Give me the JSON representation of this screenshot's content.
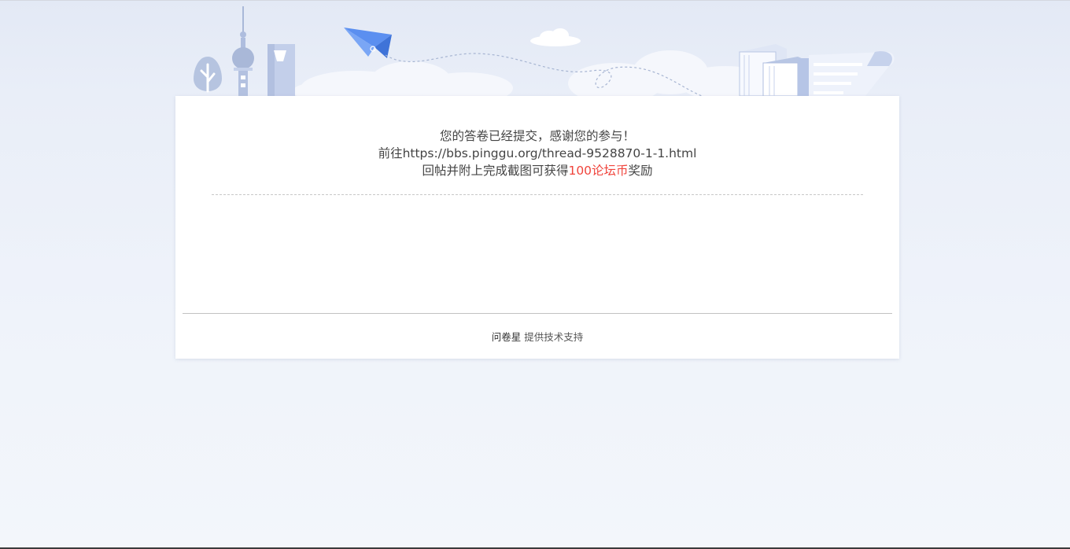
{
  "confirmation": {
    "line1": "您的答卷已经提交，感谢您的参与！",
    "line2": "前往https://bbs.pinggu.org/thread-9528870-1-1.html",
    "line3_before": "回帖并附上完成截图可获得",
    "line3_highlight": "100论坛币",
    "line3_after": "奖励"
  },
  "footer": {
    "brand": "问卷星",
    "support_text": "提供技术支持"
  },
  "colors": {
    "highlight": "#f0443c",
    "page_background": "#eef2f9",
    "card_background": "#ffffff"
  },
  "banner_icons": [
    "tree-icon",
    "tv-tower-icon",
    "skyscraper-icon",
    "paper-plane-icon",
    "cloud-icon",
    "books-icon",
    "document-scroll-icon"
  ]
}
